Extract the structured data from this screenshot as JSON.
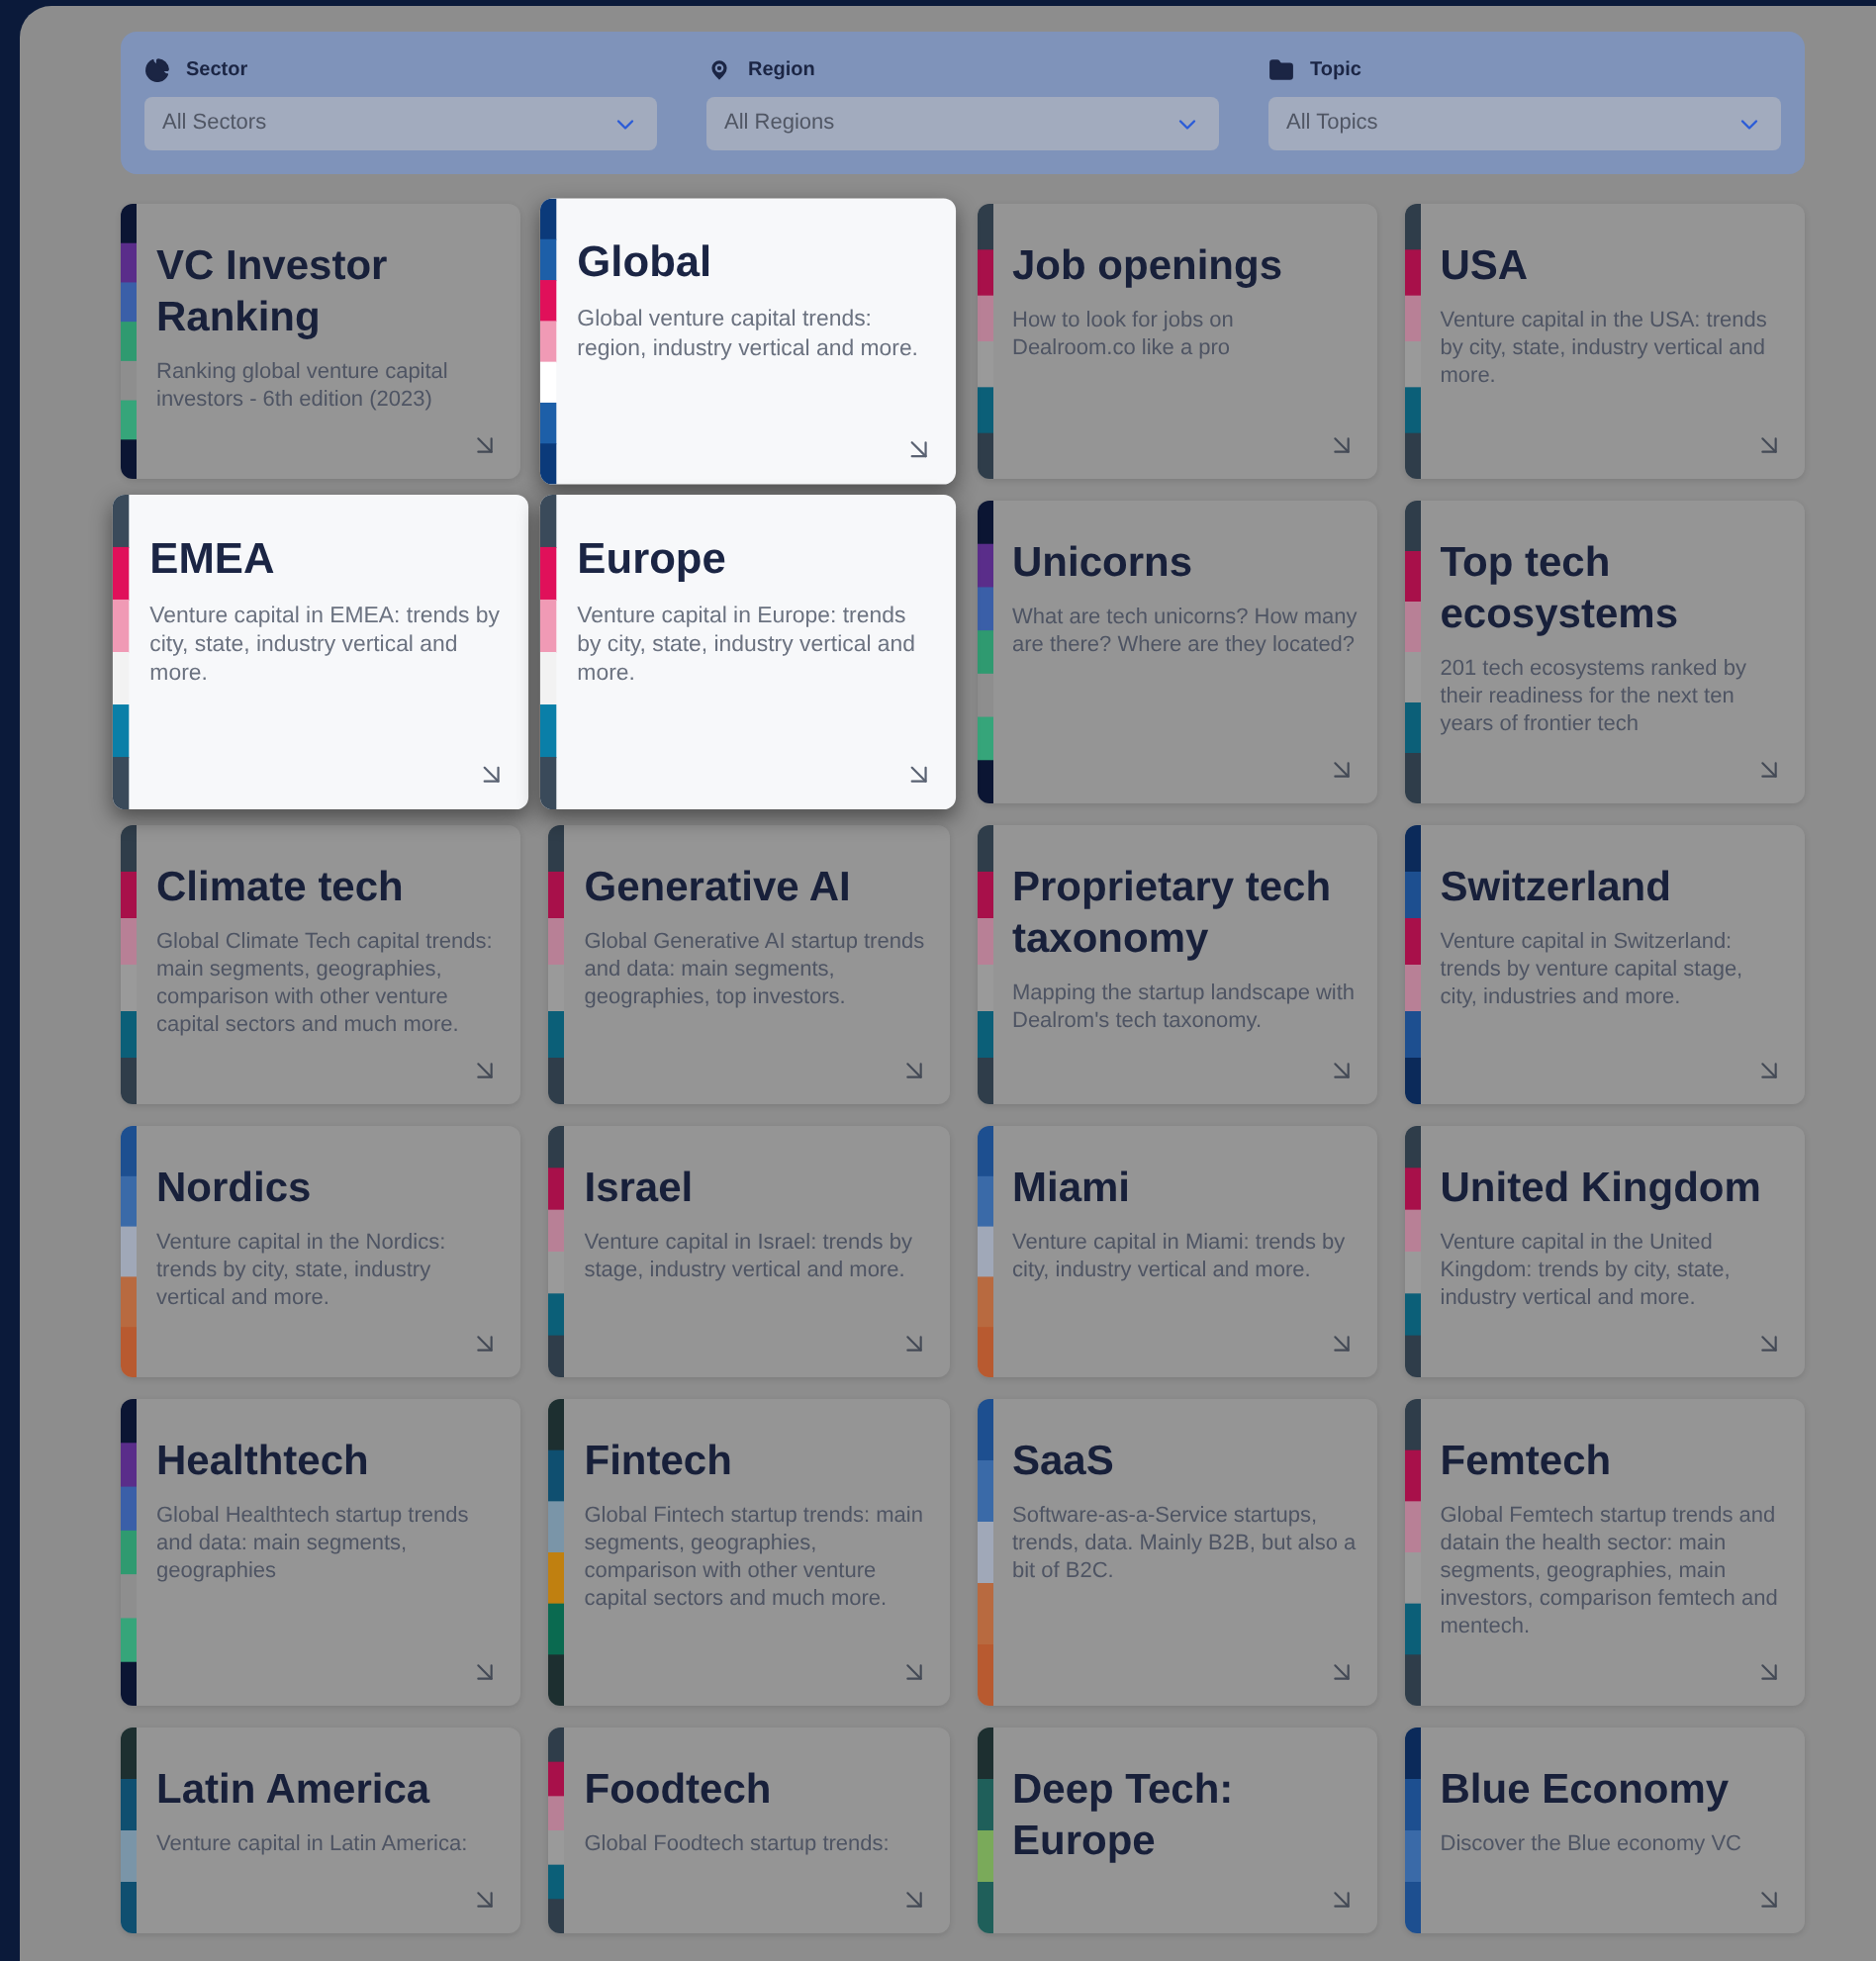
{
  "filters": [
    {
      "kind": "sector",
      "label": "Sector",
      "value": "All Sectors"
    },
    {
      "kind": "region",
      "label": "Region",
      "value": "All Regions"
    },
    {
      "kind": "topic",
      "label": "Topic",
      "value": "All Topics"
    }
  ],
  "cards": [
    {
      "title": "VC Investor Ranking",
      "description": "Ranking global venture capital investors - 6th edition (2023)",
      "highlighted": false,
      "kind": "purple"
    },
    {
      "title": "Global",
      "description": "Global venture capital trends: region, industry vertical and more.",
      "highlighted": true,
      "kind": "navy"
    },
    {
      "title": "Job openings",
      "description": "How to look for jobs on Dealroom.co like a pro",
      "highlighted": false,
      "kind": "pink"
    },
    {
      "title": "USA",
      "description": "Venture capital in the USA: trends by city, state, industry vertical and more.",
      "highlighted": false,
      "kind": "pink"
    },
    {
      "title": "EMEA",
      "description": "Venture capital in EMEA: trends by city, state, industry vertical and more.",
      "highlighted": true,
      "kind": "pink"
    },
    {
      "title": "Europe",
      "description": "Venture capital in Europe: trends by city, state, industry vertical and more.",
      "highlighted": true,
      "kind": "pink"
    },
    {
      "title": "Unicorns",
      "description": "What are tech unicorns? How many are there? Where are they located?",
      "highlighted": false,
      "kind": "purple"
    },
    {
      "title": "Top tech ecosystems",
      "description": "201 tech ecosystems ranked by their readiness for the next ten years of frontier tech",
      "highlighted": false,
      "kind": "pink"
    },
    {
      "title": "Climate tech",
      "description": "Global Climate Tech capital trends: main segments, geographies, comparison with other venture capital sectors and much more.",
      "highlighted": false,
      "kind": "pink"
    },
    {
      "title": "Generative AI",
      "description": "Global Generative AI startup trends and data: main segments, geographies, top investors.",
      "highlighted": false,
      "kind": "pink"
    },
    {
      "title": "Proprietary tech taxonomy",
      "description": "Mapping the startup landscape with Dealrom's tech taxonomy.",
      "highlighted": false,
      "kind": "pink"
    },
    {
      "title": "Switzerland",
      "description": "Venture capital in Switzerland: trends by venture capital stage, city, industries and more.",
      "highlighted": false,
      "kind": "navy"
    },
    {
      "title": "Nordics",
      "description": "Venture capital in the Nordics: trends by city, state, industry vertical and more.",
      "highlighted": false,
      "kind": "orange"
    },
    {
      "title": "Israel",
      "description": "Venture capital in Israel: trends by stage, industry vertical and more.",
      "highlighted": false,
      "kind": "pink"
    },
    {
      "title": "Miami",
      "description": "Venture capital in Miami: trends by city, industry vertical and more.",
      "highlighted": false,
      "kind": "orange"
    },
    {
      "title": "United Kingdom",
      "description": "Venture capital in the United Kingdom: trends by city, state, industry vertical and more.",
      "highlighted": false,
      "kind": "pink"
    },
    {
      "title": "Healthtech",
      "description": "Global Healthtech startup trends and data: main segments, geographies",
      "highlighted": false,
      "kind": "purple"
    },
    {
      "title": "Fintech",
      "description": "Global Fintech startup trends: main segments, geographies, comparison with other venture capital sectors and much more.",
      "highlighted": false,
      "kind": "amber"
    },
    {
      "title": "SaaS",
      "description": "Software-as-a-Service startups, trends, data. Mainly B2B, but also a bit of B2C.",
      "highlighted": false,
      "kind": "orange"
    },
    {
      "title": "Femtech",
      "description": "Global Femtech startup trends and datain the health sector: main segments, geographies, main investors, comparison femtech and mentech.",
      "highlighted": false,
      "kind": "pink"
    },
    {
      "title": "Latin America",
      "description": "Venture capital in Latin America:",
      "highlighted": false,
      "kind": "teal"
    },
    {
      "title": "Foodtech",
      "description": "Global Foodtech startup trends:",
      "highlighted": false,
      "kind": "pink"
    },
    {
      "title": "Deep Tech: Europe",
      "highlighted": false,
      "kind": "lime"
    },
    {
      "title": "Blue Economy",
      "description": "Discover the Blue economy VC",
      "highlighted": false,
      "kind": "blue"
    }
  ]
}
